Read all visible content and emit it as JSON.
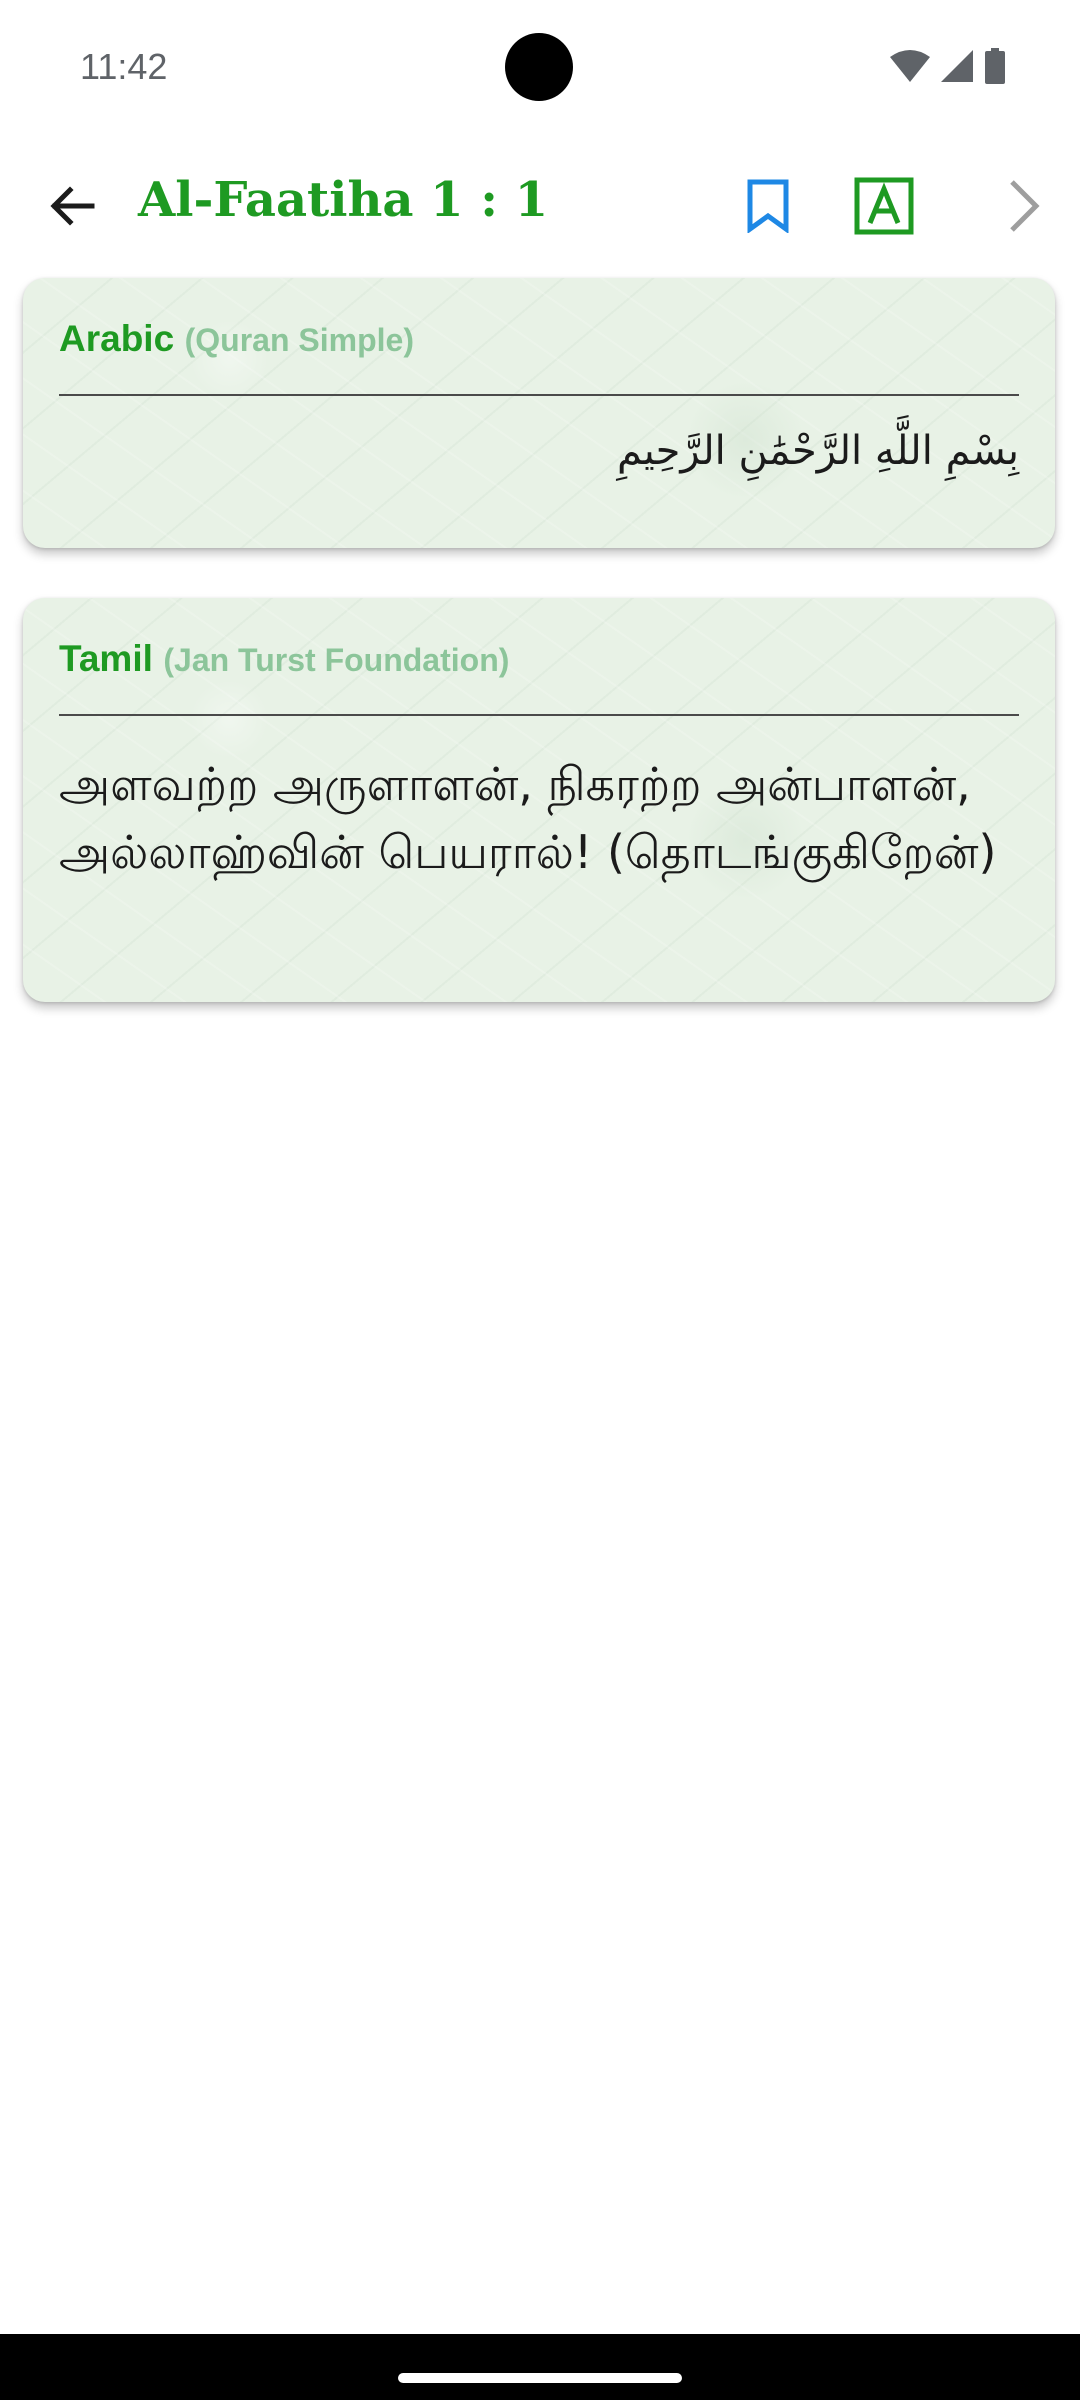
{
  "status_bar": {
    "time": "11:42",
    "icons": [
      "wifi-icon",
      "signal-icon",
      "battery-icon"
    ]
  },
  "app_bar": {
    "title": "Al-Faatiha  1 : 1",
    "back_icon": "arrow-left-icon",
    "bookmark_icon": "bookmark-icon",
    "font_icon": "letter-a-icon",
    "font_icon_letter": "A",
    "next_icon": "chevron-right-icon",
    "colors": {
      "accent": "#1e9a22",
      "bookmark": "#1e88e5",
      "disabled": "#9e9e9e"
    }
  },
  "cards": [
    {
      "language": "Arabic",
      "source": "(Quran Simple)",
      "text": "بِسْمِ اللَّهِ الرَّحْمَٰنِ الرَّحِيمِ"
    },
    {
      "language": "Tamil",
      "source": "(Jan Turst Foundation)",
      "text": "அளவற்ற அருளாளன், நிகரற்ற அன்பாளன், அல்லாஹ்வின் பெயரால்! (தொடங்குகிறேன்)"
    }
  ]
}
